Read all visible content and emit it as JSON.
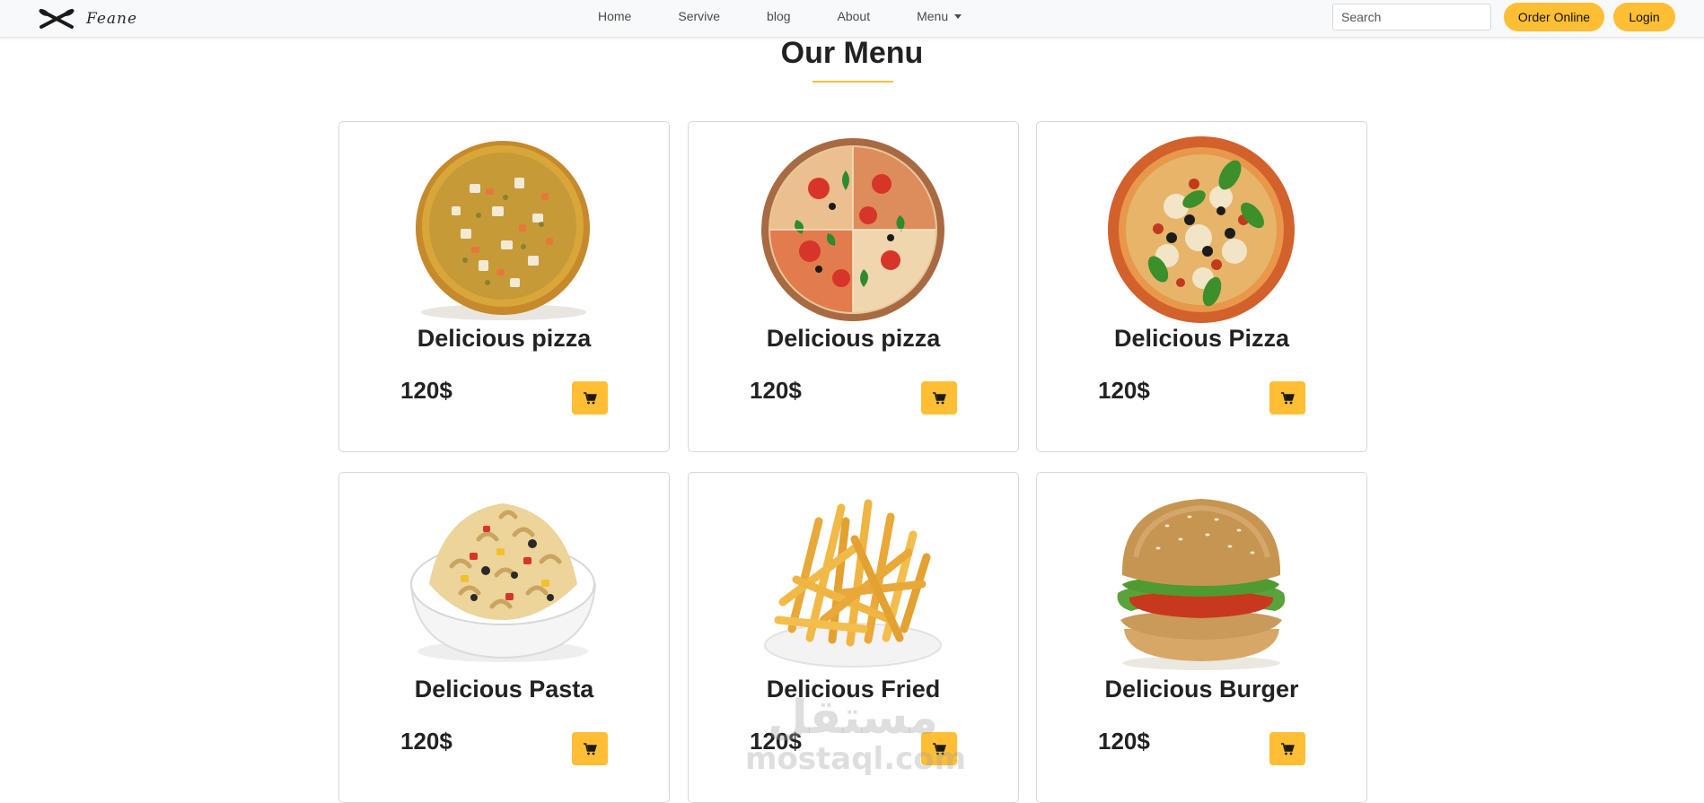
{
  "brand": {
    "name": "Feane",
    "logo_icon": "fork-knife-icon"
  },
  "nav": {
    "links": [
      "Home",
      "Servive",
      "blog",
      "About",
      "Menu"
    ],
    "menu_dropdown_icon": "caret-down-icon"
  },
  "search": {
    "placeholder": "Search",
    "value": ""
  },
  "buttons": {
    "order_online": "Order Online",
    "login": "Login"
  },
  "section": {
    "title": "Our Menu"
  },
  "menu_items": [
    {
      "name": "Delicious pizza",
      "price": "120$",
      "image": "pizza-shrimp-image",
      "cart_icon": "cart-icon"
    },
    {
      "name": "Delicious pizza",
      "price": "120$",
      "image": "pizza-slices-image",
      "cart_icon": "cart-icon"
    },
    {
      "name": "Delicious Pizza",
      "price": "120$",
      "image": "pizza-basil-olives-image",
      "cart_icon": "cart-icon"
    },
    {
      "name": "Delicious Pasta",
      "price": "120$",
      "image": "pasta-bowl-image",
      "cart_icon": "cart-icon"
    },
    {
      "name": "Delicious Fried",
      "price": "120$",
      "image": "french-fries-image",
      "cart_icon": "cart-icon"
    },
    {
      "name": "Delicious Burger",
      "price": "120$",
      "image": "burger-image",
      "cart_icon": "cart-icon"
    }
  ],
  "watermark": {
    "arabic": "مستقل",
    "latin": "mostaql.com"
  },
  "colors": {
    "accent": "#ffbe33",
    "navbar_bg": "#f8f9fa",
    "text_dark": "#222222"
  }
}
